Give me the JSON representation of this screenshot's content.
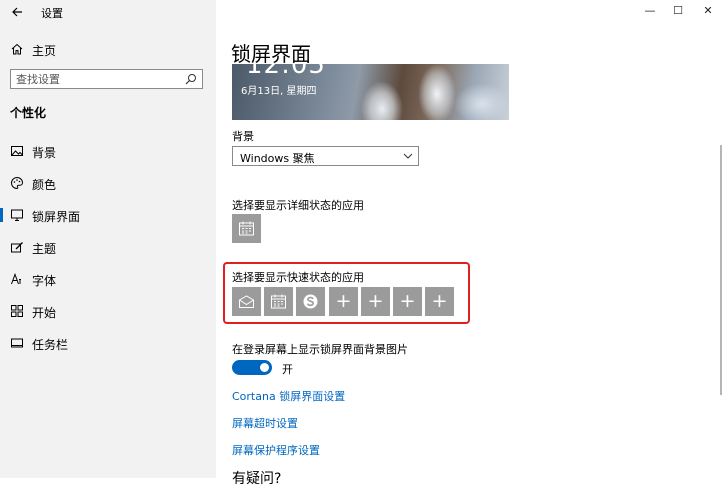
{
  "window": {
    "title": "设置",
    "back_icon": "back-arrow-icon",
    "minimize": "—",
    "maximize": "☐",
    "close": "✕"
  },
  "sidebar": {
    "home": {
      "label": "主页",
      "icon": "home-icon"
    },
    "search": {
      "placeholder": "查找设置",
      "icon": "search-icon"
    },
    "section_title": "个性化",
    "items": [
      {
        "label": "背景",
        "icon": "picture-icon"
      },
      {
        "label": "颜色",
        "icon": "palette-icon"
      },
      {
        "label": "锁屏界面",
        "icon": "lock-screen-icon",
        "active": true
      },
      {
        "label": "主题",
        "icon": "theme-brush-icon"
      },
      {
        "label": "字体",
        "icon": "font-icon"
      },
      {
        "label": "开始",
        "icon": "start-grid-icon"
      },
      {
        "label": "任务栏",
        "icon": "taskbar-icon"
      }
    ]
  },
  "main": {
    "title": "锁屏界面",
    "preview": {
      "time": "12:05",
      "date": "6月13日, 星期四"
    },
    "background_label": "背景",
    "background_value": "Windows 聚焦",
    "detailed_label": "选择要显示详细状态的应用",
    "quick_label": "选择要显示快速状态的应用",
    "plus": "+",
    "signin_label": "在登录屏幕上显示锁屏界面背景图片",
    "toggle_state": "开",
    "links": [
      "Cortana 锁屏界面设置",
      "屏幕超时设置",
      "屏幕保护程序设置"
    ],
    "help_title": "有疑问?"
  },
  "colors": {
    "accent": "#0067c0",
    "highlight": "#e02020",
    "tile": "#9b9b9b"
  }
}
